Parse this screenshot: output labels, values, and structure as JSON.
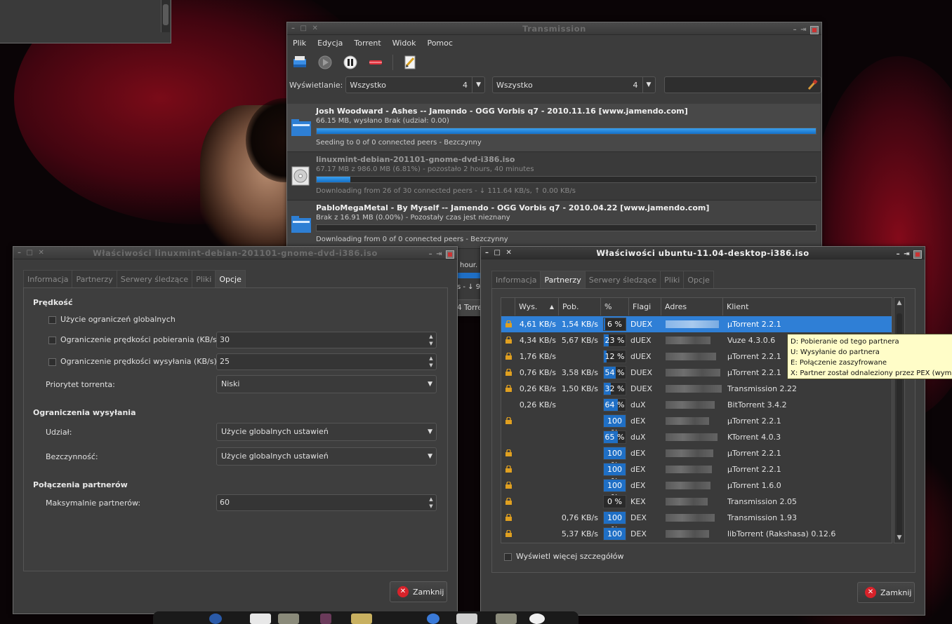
{
  "main_window": {
    "title": "Transmission",
    "menu": [
      "Plik",
      "Edycja",
      "Torrent",
      "Widok",
      "Pomoc"
    ],
    "toolbar_icons": [
      "add-torrent-icon",
      "start-icon",
      "pause-icon",
      "remove-icon",
      "properties-icon"
    ],
    "filter": {
      "label": "Wyświetlanie:",
      "combo1_value": "Wszystko",
      "combo1_count": "4",
      "combo2_value": "Wszystko",
      "combo2_count": "4",
      "search_value": ""
    },
    "torrents": [
      {
        "name": "Josh Woodward - Ashes -- Jamendo - OGG Vorbis q7 - 2010.11.16 [www.jamendo.com]",
        "sub": "66.15 MB, wysłano Brak (udział: 0.00)",
        "progress": 1.0,
        "status": "Seeding to 0 of 0 connected peers - Bezczynny",
        "icon": "folder-icon"
      },
      {
        "name": "linuxmint-debian-201101-gnome-dvd-i386.iso",
        "sub": "67.17 MB z 986.0 MB (6.81%) - pozostało 2 hours, 40 minutes",
        "progress": 0.0681,
        "status": "Downloading from 26 of 30 connected peers - ↓ 111.64 KB/s, ↑ 0.00 KB/s",
        "icon": "disc-icon"
      },
      {
        "name": "PabloMegaMetal - By Myself -- Jamendo - OGG Vorbis q7 - 2010.04.22 [www.jamendo.com]",
        "sub": "Brak z 16.91 MB (0.00%) - Pozostały czas jest nieznany",
        "progress": 0.0,
        "status": "Downloading from 0 of 0 connected peers - Bezczynny",
        "icon": "folder-icon"
      }
    ],
    "partial_texts": {
      "hour": "hour.",
      "s95": "s - ↓ 95",
      "torre": "4 Torre"
    }
  },
  "left_window": {
    "title": "Właściwości linuxmint-debian-201101-gnome-dvd-i386.iso",
    "tabs": [
      "Informacja",
      "Partnerzy",
      "Serwery śledzące",
      "Pliki",
      "Opcje"
    ],
    "active_tab": 4,
    "speed": {
      "heading": "Prędkość",
      "use_global": "Użycie ograniczeń globalnych",
      "down_limit_label": "Ograniczenie prędkości pobierania (KB/s):",
      "down_limit_value": "30",
      "up_limit_label": "Ograniczenie prędkości wysyłania (KB/s):",
      "up_limit_value": "25",
      "priority_label": "Priorytet torrenta:",
      "priority_value": "Niski"
    },
    "seeding": {
      "heading": "Ograniczenia wysyłania",
      "ratio_label": "Udział:",
      "ratio_value": "Użycie globalnych ustawień",
      "idle_label": "Bezczynność:",
      "idle_value": "Użycie globalnych ustawień"
    },
    "peers": {
      "heading": "Połączenia partnerów",
      "max_label": "Maksymalnie partnerów:",
      "max_value": "60"
    },
    "close_label": "Zamknij"
  },
  "right_window": {
    "title": "Właściwości ubuntu-11.04-desktop-i386.iso",
    "tabs": [
      "Informacja",
      "Partnerzy",
      "Serwery śledzące",
      "Pliki",
      "Opcje"
    ],
    "active_tab": 1,
    "columns": [
      "Wys.",
      "Pob.",
      "%",
      "Flagi",
      "Adres",
      "Klient"
    ],
    "peers": [
      {
        "enc": true,
        "up": "4,61 KB/s",
        "down": "1,54 KB/s",
        "pct": 6,
        "flags": "DUEX",
        "client": "µTorrent 2.2.1"
      },
      {
        "enc": true,
        "up": "4,34 KB/s",
        "down": "5,67 KB/s",
        "pct": 23,
        "flags": "dUEX",
        "client": "Vuze 4.3.0.6"
      },
      {
        "enc": true,
        "up": "1,76 KB/s",
        "down": "",
        "pct": 12,
        "flags": "dUEX",
        "client": "µTorrent 2.2.1"
      },
      {
        "enc": true,
        "up": "0,76 KB/s",
        "down": "3,58 KB/s",
        "pct": 54,
        "flags": "DUEX",
        "client": "µTorrent 2.2.1"
      },
      {
        "enc": true,
        "up": "0,26 KB/s",
        "down": "1,50 KB/s",
        "pct": 32,
        "flags": "DUEX",
        "client": "Transmission 2.22"
      },
      {
        "enc": false,
        "up": "0,26 KB/s",
        "down": "",
        "pct": 64,
        "flags": "duX",
        "client": "BitTorrent 3.4.2"
      },
      {
        "enc": true,
        "up": "",
        "down": "",
        "pct": 100,
        "flags": "dEX",
        "client": "µTorrent 2.2.1"
      },
      {
        "enc": false,
        "up": "",
        "down": "",
        "pct": 65,
        "flags": "duX",
        "client": "KTorrent 4.0.3"
      },
      {
        "enc": true,
        "up": "",
        "down": "",
        "pct": 100,
        "flags": "dEX",
        "client": "µTorrent 2.2.1"
      },
      {
        "enc": true,
        "up": "",
        "down": "",
        "pct": 100,
        "flags": "dEX",
        "client": "µTorrent 2.2.1"
      },
      {
        "enc": true,
        "up": "",
        "down": "",
        "pct": 100,
        "flags": "dEX",
        "client": "µTorrent 1.6.0"
      },
      {
        "enc": true,
        "up": "",
        "down": "",
        "pct": 0,
        "flags": "KEX",
        "client": "Transmission 2.05"
      },
      {
        "enc": true,
        "up": "",
        "down": "0,76 KB/s",
        "pct": 100,
        "flags": "DEX",
        "client": "Transmission 1.93"
      },
      {
        "enc": true,
        "up": "",
        "down": "5,37 KB/s",
        "pct": 100,
        "flags": "DEX",
        "client": "libTorrent (Rakshasa) 0.12.6"
      }
    ],
    "more_details_label": "Wyświetl więcej szczegółów",
    "close_label": "Zamknij",
    "tooltip": [
      "D: Pobieranie od tego partnera",
      "U: Wysyłanie do partnera",
      "E: Połączenie zaszyfrowane",
      "X: Partner został odnaleziony przez PEX (wymiana partnerów)"
    ]
  },
  "colors": {
    "accent": "#2f7fd6",
    "progress": "#1f6fc5",
    "close_red": "#d8222a",
    "tooltip_bg": "#fffdc8"
  }
}
